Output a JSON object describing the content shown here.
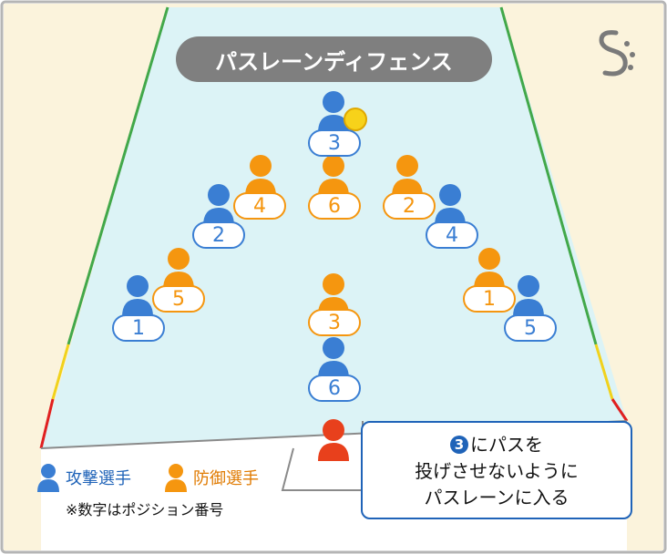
{
  "title": "パスレーンディフェンス",
  "colors": {
    "attack": "#3a7ed3",
    "defense": "#f5960f",
    "target": "#e8401c",
    "ball": "#f7d21a",
    "court": "#d8f3f6"
  },
  "attackers": [
    {
      "num": "3",
      "has_ball": true
    },
    {
      "num": "2"
    },
    {
      "num": "4"
    },
    {
      "num": "1"
    },
    {
      "num": "5"
    },
    {
      "num": "6"
    }
  ],
  "defenders": [
    {
      "num": "4"
    },
    {
      "num": "6"
    },
    {
      "num": "2"
    },
    {
      "num": "5"
    },
    {
      "num": "1"
    },
    {
      "num": "3"
    }
  ],
  "callout": {
    "badge": "3",
    "line1_rest": "にパスを",
    "line2": "投げさせないように",
    "line3": "パスレーンに入る"
  },
  "legend": {
    "attack_label": "攻撃選手",
    "defense_label": "防御選手"
  },
  "note": "※数字はポジション番号",
  "logo_icon": "sports-logo-icon"
}
